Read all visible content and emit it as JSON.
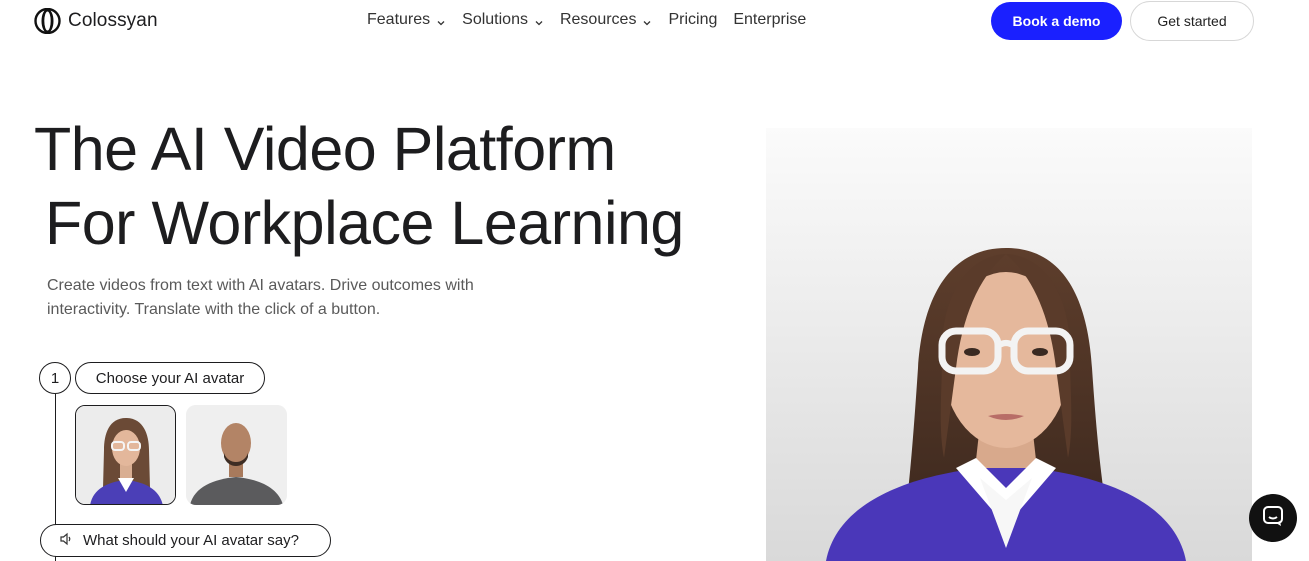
{
  "brand": {
    "name": "Colossyan",
    "accent": "#1a20ff"
  },
  "nav": {
    "items": [
      {
        "label": "Features",
        "has_dropdown": true
      },
      {
        "label": "Solutions",
        "has_dropdown": true
      },
      {
        "label": "Resources",
        "has_dropdown": true
      },
      {
        "label": "Pricing",
        "has_dropdown": false
      },
      {
        "label": "Enterprise",
        "has_dropdown": false
      }
    ]
  },
  "header": {
    "demo_label": "Book a demo",
    "start_label": "Get started"
  },
  "hero": {
    "title_line1": "The AI Video Platform",
    "title_line2": "For Workplace Learning",
    "subtitle": "Create videos from text with AI avatars. Drive outcomes with interactivity. Translate with the click of a button."
  },
  "steps": {
    "step1_number": "1",
    "step1_label": "Choose your AI avatar",
    "step2_label": "What should your AI avatar say?"
  },
  "icons": {
    "chat": "chat-bubble-icon",
    "speaker": "speaker-icon",
    "chevron": "chevron-down-icon"
  }
}
